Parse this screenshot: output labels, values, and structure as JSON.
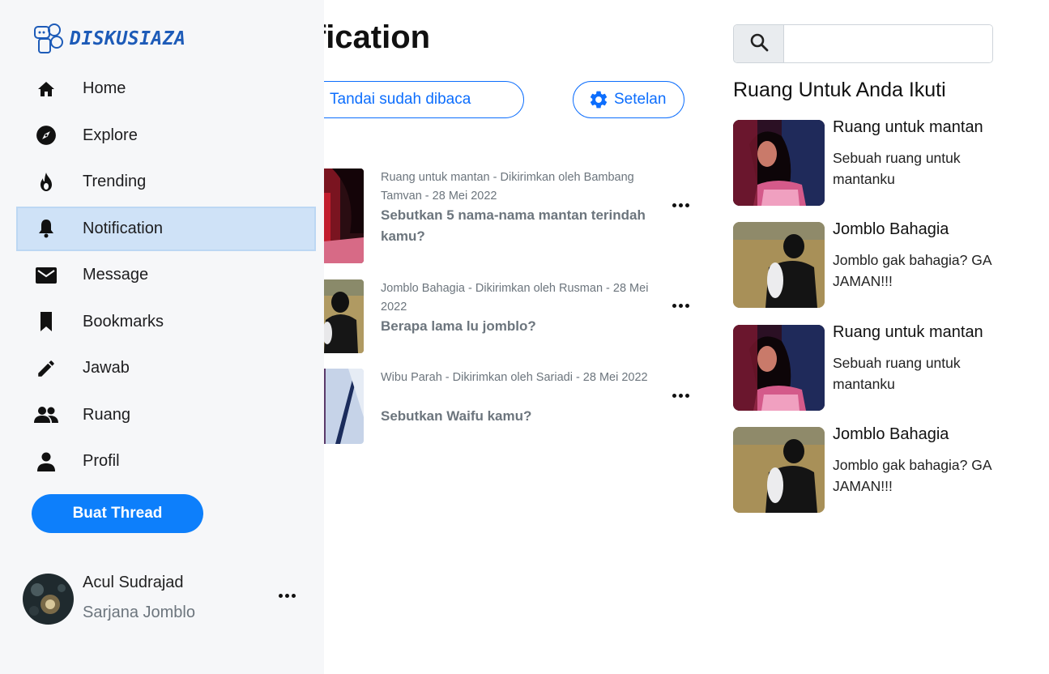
{
  "app": {
    "brand": "DISKUSIAZA"
  },
  "sidebar": {
    "items": [
      {
        "label": "Home",
        "icon": "home-icon"
      },
      {
        "label": "Explore",
        "icon": "compass-icon"
      },
      {
        "label": "Trending",
        "icon": "flame-icon"
      },
      {
        "label": "Notification",
        "icon": "bell-icon",
        "active": true
      },
      {
        "label": "Message",
        "icon": "envelope-icon"
      },
      {
        "label": "Bookmarks",
        "icon": "bookmark-icon"
      },
      {
        "label": "Jawab",
        "icon": "pencil-icon"
      },
      {
        "label": "Ruang",
        "icon": "people-icon"
      },
      {
        "label": "Profil",
        "icon": "person-icon"
      }
    ],
    "cta_label": "Buat Thread",
    "user": {
      "name": "Acul Sudrajad",
      "role": "Sarjana Jomblo"
    }
  },
  "main": {
    "title": "otification",
    "mark_read_label": "Tandai sudah dibaca",
    "settings_label": "Setelan",
    "notifications": [
      {
        "meta": "Ruang untuk mantan - Dikirimkan oleh Bambang Tamvan - 28 Mei 2022",
        "question": "Sebutkan 5 nama-nama mantan terindah kamu?"
      },
      {
        "meta": "Jomblo Bahagia - Dikirimkan oleh Rusman - 28 Mei 2022",
        "question": "Berapa lama lu jomblo?"
      },
      {
        "meta": "Wibu Parah - Dikirimkan oleh Sariadi - 28 Mei 2022",
        "question": "Sebutkan Waifu kamu?"
      }
    ]
  },
  "right": {
    "search": {
      "placeholder": ""
    },
    "heading": "Ruang Untuk Anda Ikuti",
    "rooms": [
      {
        "name": "Ruang untuk mantan",
        "desc": "Sebuah ruang untuk mantanku"
      },
      {
        "name": "Jomblo Bahagia",
        "desc": "Jomblo gak bahagia? GA JAMAN!!!"
      },
      {
        "name": "Ruang untuk mantan",
        "desc": "Sebuah ruang untuk mantanku"
      },
      {
        "name": "Jomblo Bahagia",
        "desc": "Jomblo gak bahagia? GA JAMAN!!!"
      }
    ]
  },
  "colors": {
    "accent": "#0d7ffb",
    "active_bg": "#cfe2f7",
    "sidebar_bg": "#f6f7f9",
    "brand": "#1d5bb8"
  }
}
